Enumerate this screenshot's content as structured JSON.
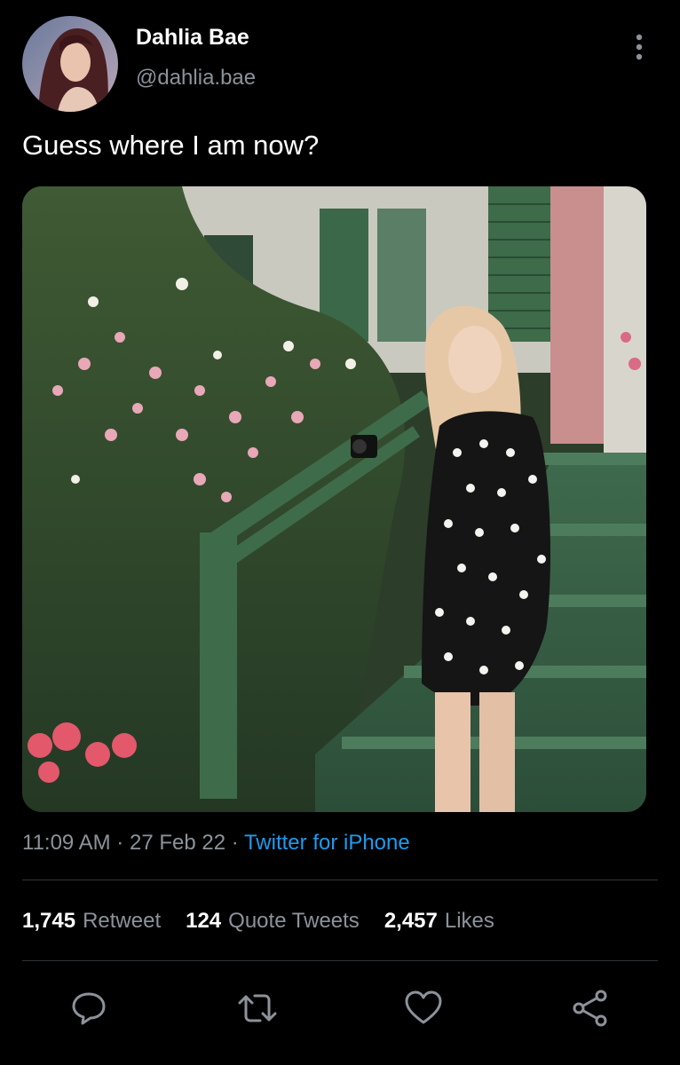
{
  "author": {
    "name": "Dahlia Bae",
    "handle": "@dahlia.bae"
  },
  "tweet": {
    "text": "Guess where I am now?"
  },
  "meta": {
    "time": "11:09 AM",
    "sep1": "·",
    "date": "27 Feb 22",
    "sep2": "·",
    "source": "Twitter for iPhone"
  },
  "stats": {
    "retweets": {
      "count": "1,745",
      "label": "Retweet"
    },
    "quotes": {
      "count": "124",
      "label": "Quote Tweets"
    },
    "likes": {
      "count": "2,457",
      "label": "Likes"
    }
  },
  "icons": {
    "more": "more-vertical-icon",
    "reply": "reply-icon",
    "retweet": "retweet-icon",
    "like": "heart-icon",
    "share": "share-icon"
  },
  "colors": {
    "background": "#000000",
    "muted": "#8b9299",
    "link": "#1d9bf0",
    "divider": "#2f3336"
  }
}
